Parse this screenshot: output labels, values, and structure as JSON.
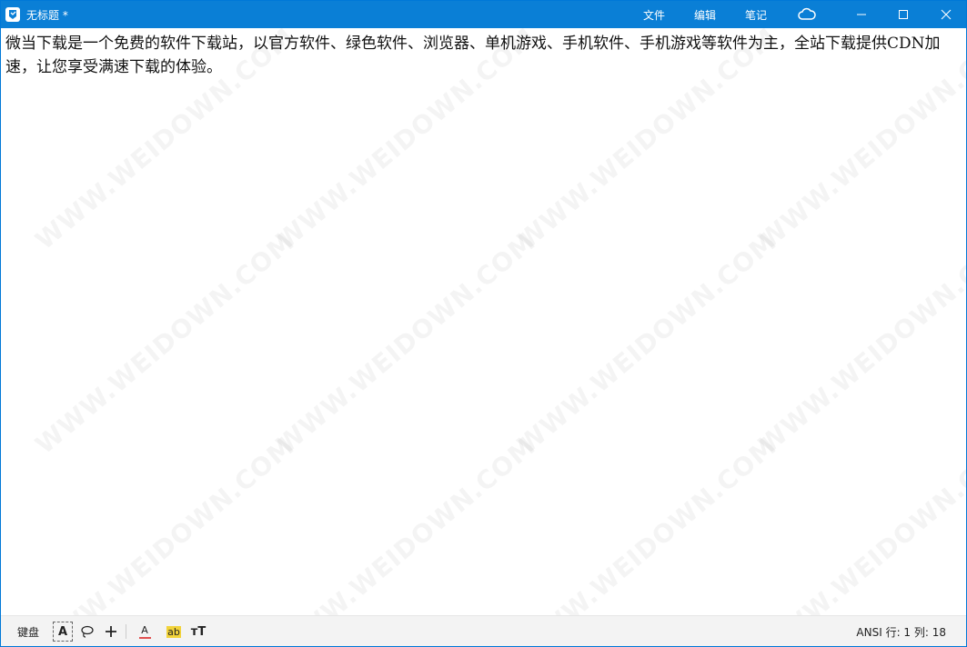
{
  "window": {
    "title": "无标题 *"
  },
  "menu": {
    "file": "文件",
    "edit": "编辑",
    "notes": "笔记"
  },
  "editor": {
    "text": "微当下载是一个免费的软件下载站，以官方软件、绿色软件、浏览器、单机游戏、手机软件、手机游戏等软件为主，全站下载提供CDN加速，让您享受满速下载的体验。",
    "watermark": "WWW.WEIDOWN.COM"
  },
  "statusbar": {
    "keyboard": "键盘",
    "text_tool": "A",
    "color_tool": "A",
    "highlight_tool": "ab",
    "size_tool": "тT",
    "encoding": "ANSI",
    "position": "行: 1 列: 18"
  },
  "colors": {
    "titlebar": "#0a7fd6",
    "accent": "#0078d7"
  }
}
